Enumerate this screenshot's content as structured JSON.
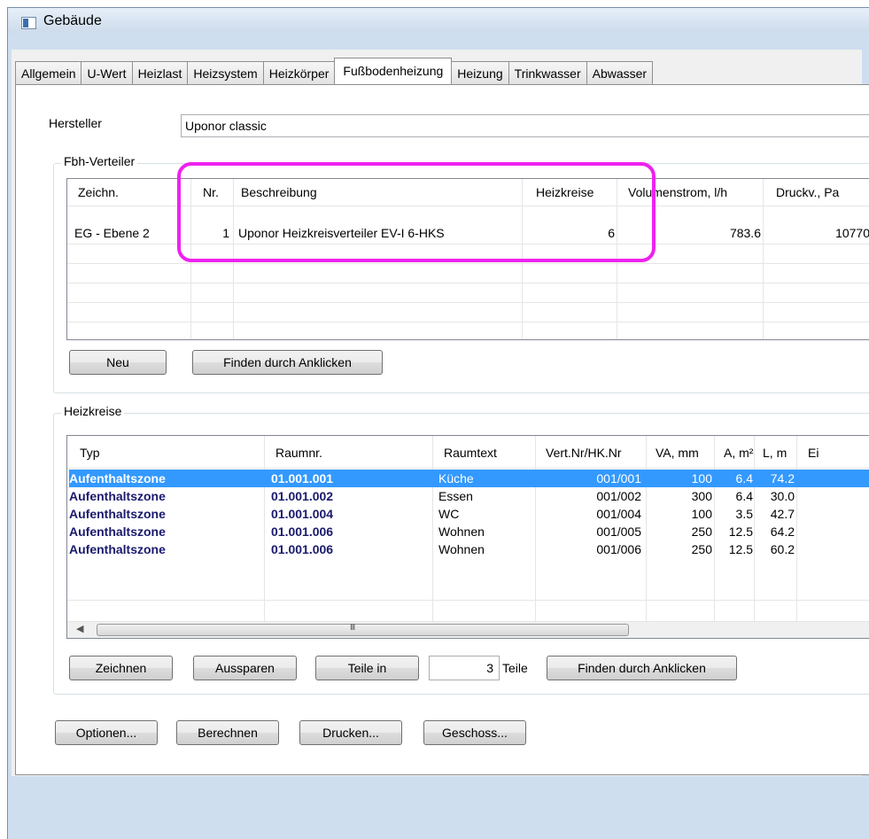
{
  "window": {
    "title": "Gebäude"
  },
  "tabs": [
    "Allgemein",
    "U-Wert",
    "Heizlast",
    "Heizsystem",
    "Heizkörper",
    "Fußbodenheizung",
    "Heizung",
    "Trinkwasser",
    "Abwasser"
  ],
  "active_tab": "Fußbodenheizung",
  "hersteller": {
    "label": "Hersteller",
    "value": "Uponor classic"
  },
  "verteiler": {
    "group_title": "Fbh-Verteiler",
    "columns": [
      "Zeichn.",
      "Nr.",
      "Beschreibung",
      "Heizkreise",
      "Volumenstrom, l/h",
      "Druckv., Pa"
    ],
    "rows": [
      {
        "zeichn": "EG - Ebene 2",
        "nr": "1",
        "beschreibung": "Uponor Heizkreisverteiler EV-I 6-HKS",
        "heizkreise": "6",
        "volumenstrom": "783.6",
        "druckv": "10770"
      }
    ],
    "buttons": {
      "neu": "Neu",
      "finden": "Finden durch Anklicken"
    }
  },
  "heizkreise": {
    "group_title": "Heizkreise",
    "columns": [
      "Typ",
      "Raumnr.",
      "Raumtext",
      "Vert.Nr/HK.Nr",
      "VA, mm",
      "A, m²",
      "L, m",
      "Ei"
    ],
    "rows": [
      {
        "typ": "Aufenthaltszone",
        "raumnr": "01.001.001",
        "raumtext": "Küche",
        "vert": "001/001",
        "va": "100",
        "a": "6.4",
        "l": "74.2"
      },
      {
        "typ": "Aufenthaltszone",
        "raumnr": "01.001.002",
        "raumtext": "Essen",
        "vert": "001/002",
        "va": "300",
        "a": "6.4",
        "l": "30.0"
      },
      {
        "typ": "Aufenthaltszone",
        "raumnr": "01.001.004",
        "raumtext": "WC",
        "vert": "001/004",
        "va": "100",
        "a": "3.5",
        "l": "42.7"
      },
      {
        "typ": "Aufenthaltszone",
        "raumnr": "01.001.006",
        "raumtext": "Wohnen",
        "vert": "001/005",
        "va": "250",
        "a": "12.5",
        "l": "64.2"
      },
      {
        "typ": "Aufenthaltszone",
        "raumnr": "01.001.006",
        "raumtext": "Wohnen",
        "vert": "001/006",
        "va": "250",
        "a": "12.5",
        "l": "60.2"
      }
    ],
    "scroll_grip": "III",
    "buttons": {
      "zeichnen": "Zeichnen",
      "aussparen": "Aussparen",
      "teile_in": "Teile in",
      "finden": "Finden durch Anklicken"
    },
    "teile_value": "3",
    "teile_label": "Teile"
  },
  "bottom_buttons": {
    "optionen": "Optionen...",
    "berechnen": "Berechnen",
    "drucken": "Drucken...",
    "geschoss": "Geschoss..."
  },
  "colors": {
    "highlight": "#ee22ee",
    "selection": "#3399ff"
  }
}
